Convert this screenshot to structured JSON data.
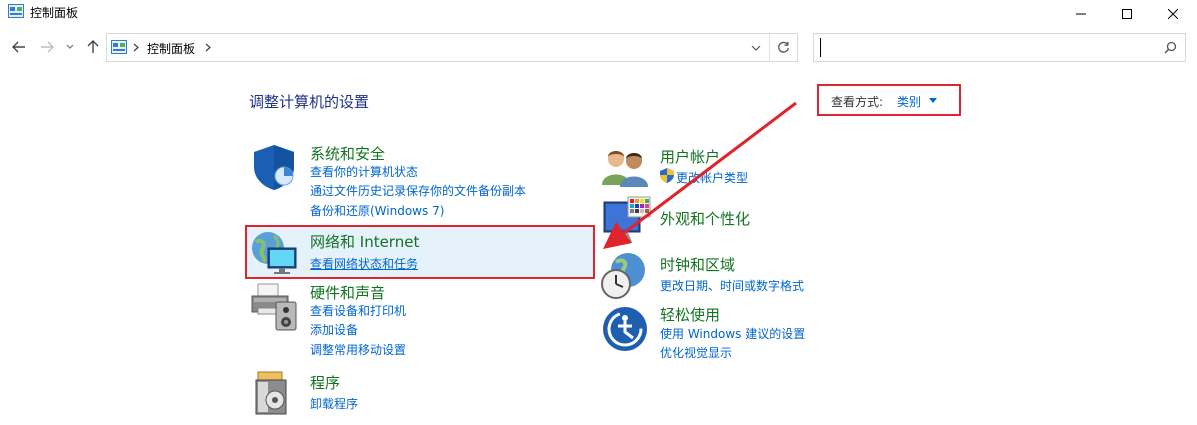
{
  "window": {
    "title": "控制面板"
  },
  "address": {
    "path": "控制面板"
  },
  "search": {
    "placeholder": ""
  },
  "content": {
    "heading": "调整计算机的设置",
    "view_by": {
      "label": "查看方式:",
      "value": "类别"
    },
    "categories": [
      {
        "title": "系统和安全",
        "links": [
          "查看你的计算机状态",
          "通过文件历史记录保存你的文件备份副本",
          "备份和还原(Windows 7)"
        ]
      },
      {
        "title": "网络和 Internet",
        "links": [
          "查看网络状态和任务"
        ]
      },
      {
        "title": "硬件和声音",
        "links": [
          "查看设备和打印机",
          "添加设备",
          "调整常用移动设置"
        ]
      },
      {
        "title": "程序",
        "links": [
          "卸载程序"
        ]
      },
      {
        "title": "用户帐户",
        "links": [
          "更改帐户类型"
        ]
      },
      {
        "title": "外观和个性化",
        "links": []
      },
      {
        "title": "时钟和区域",
        "links": [
          "更改日期、时间或数字格式"
        ]
      },
      {
        "title": "轻松使用",
        "links": [
          "使用 Windows 建议的设置",
          "优化视觉显示"
        ]
      }
    ]
  },
  "colors": {
    "category_title": "#12741f",
    "link": "#0066cc",
    "heading": "#1e3287",
    "annotation": "#e0242e",
    "highlight_bg": "#e5f1fb"
  }
}
